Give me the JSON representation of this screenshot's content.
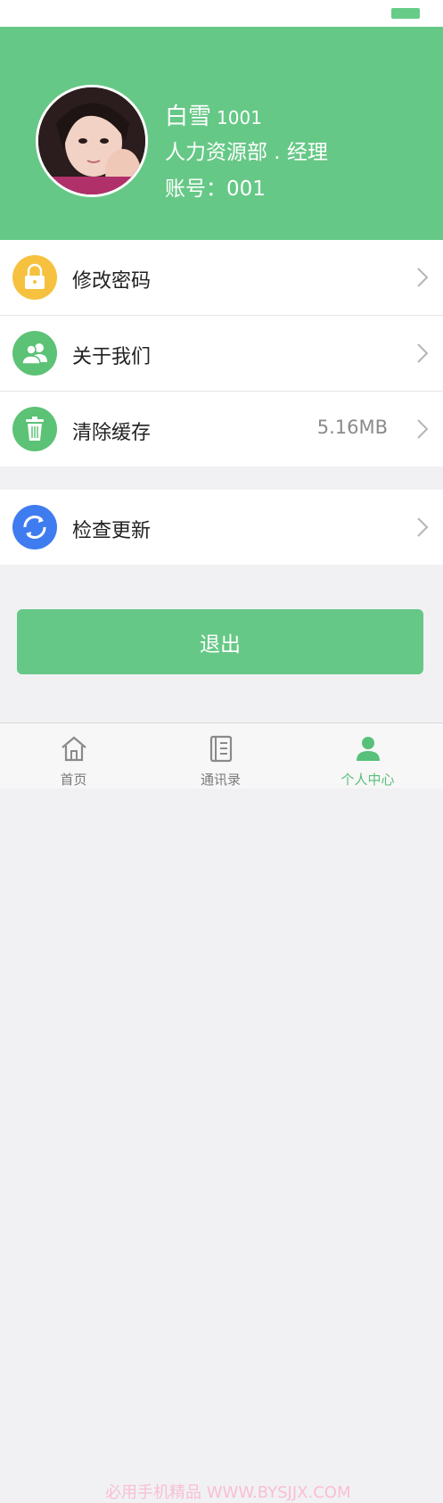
{
  "profile": {
    "name": "白雪",
    "id": "1001",
    "department": "人力资源部 . 经理",
    "account": "账号：001"
  },
  "menu": {
    "change_password": "修改密码",
    "about_us": "关于我们",
    "clear_cache": "清除缓存",
    "cache_size": "5.16MB",
    "check_update": "检查更新"
  },
  "logout_label": "退出",
  "tabs": [
    {
      "label": "首页",
      "icon": "home-icon"
    },
    {
      "label": "通讯录",
      "icon": "contacts-book-icon"
    },
    {
      "label": "个人中心",
      "icon": "person-icon"
    }
  ],
  "watermark": "必用手机精品 WWW.BYSJJX.COM",
  "colors": {
    "accent": "#66c886",
    "lock_icon_bg": "#f6c13f",
    "about_icon_bg": "#5cc276",
    "trash_icon_bg": "#5cc276",
    "update_icon_bg": "#3f7cf0"
  }
}
